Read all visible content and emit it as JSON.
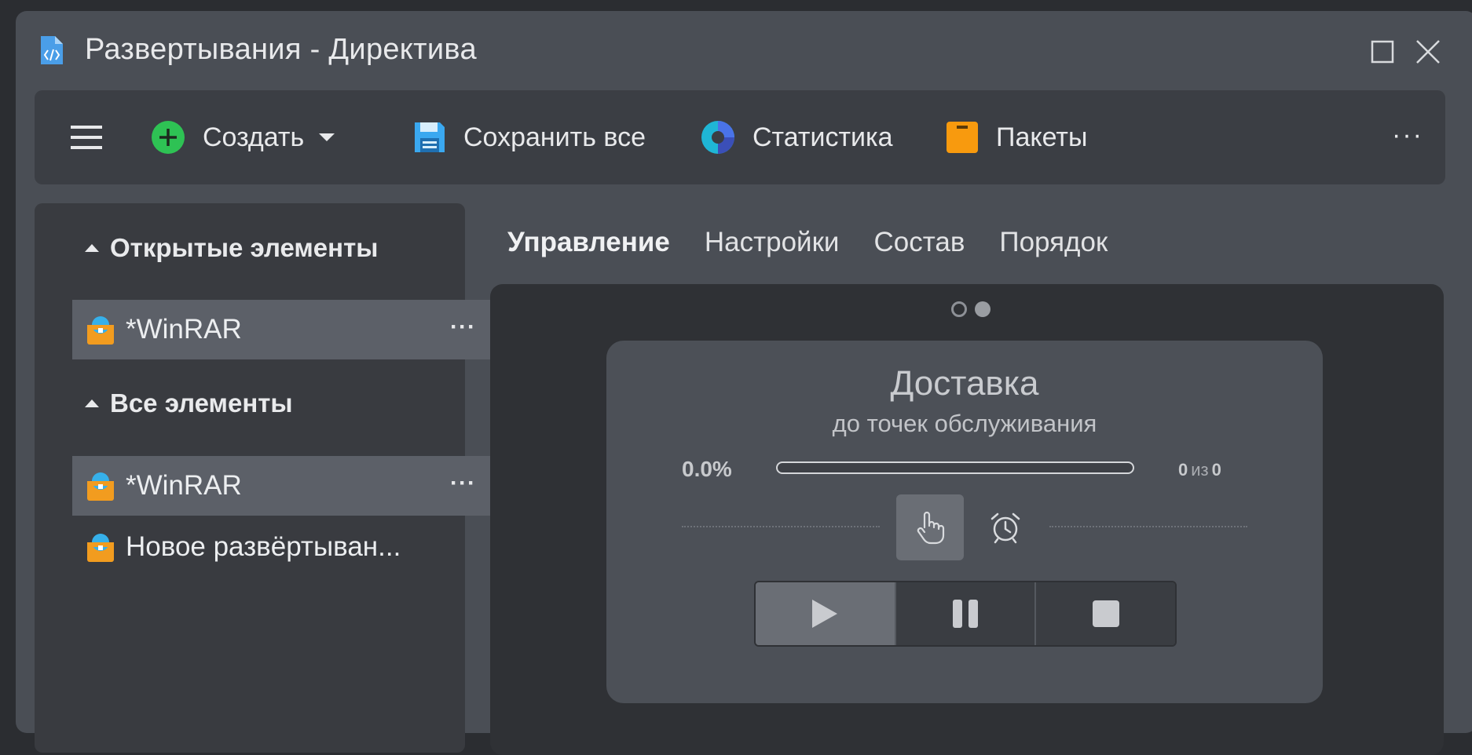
{
  "window": {
    "title": "Развертывания - Директива",
    "icon": "code-document-icon"
  },
  "toolbar": {
    "menu_icon": "hamburger-menu-icon",
    "create_label": "Создать",
    "save_all_label": "Сохранить все",
    "stats_label": "Статистика",
    "packages_label": "Пакеты",
    "more_label": "···",
    "colors": {
      "create": "#2ec254",
      "save": "#3aa8f0",
      "packages": "#f89a0e"
    }
  },
  "sidebar": {
    "open_section": {
      "title": "Открытые элементы",
      "items": [
        {
          "label": "*WinRAR",
          "more": "···",
          "selected": true
        }
      ]
    },
    "all_section": {
      "title": "Все элементы",
      "items": [
        {
          "label": "*WinRAR",
          "more": "···",
          "selected": true
        },
        {
          "label": "Новое развёртыван...",
          "selected": false
        }
      ]
    }
  },
  "tabs": [
    {
      "label": "Управление",
      "active": true
    },
    {
      "label": "Настройки",
      "active": false
    },
    {
      "label": "Состав",
      "active": false
    },
    {
      "label": "Порядок",
      "active": false
    }
  ],
  "delivery": {
    "title": "Доставка",
    "subtitle": "до точек обслуживания",
    "percent_label": "0.0%",
    "progress": 0,
    "done": "0",
    "of_label": "из",
    "total": "0",
    "mode": "manual",
    "carousel": {
      "pages": 2,
      "current": 2
    }
  },
  "controls": {
    "play_icon": "play-icon",
    "pause_icon": "pause-icon",
    "stop_icon": "stop-icon"
  }
}
